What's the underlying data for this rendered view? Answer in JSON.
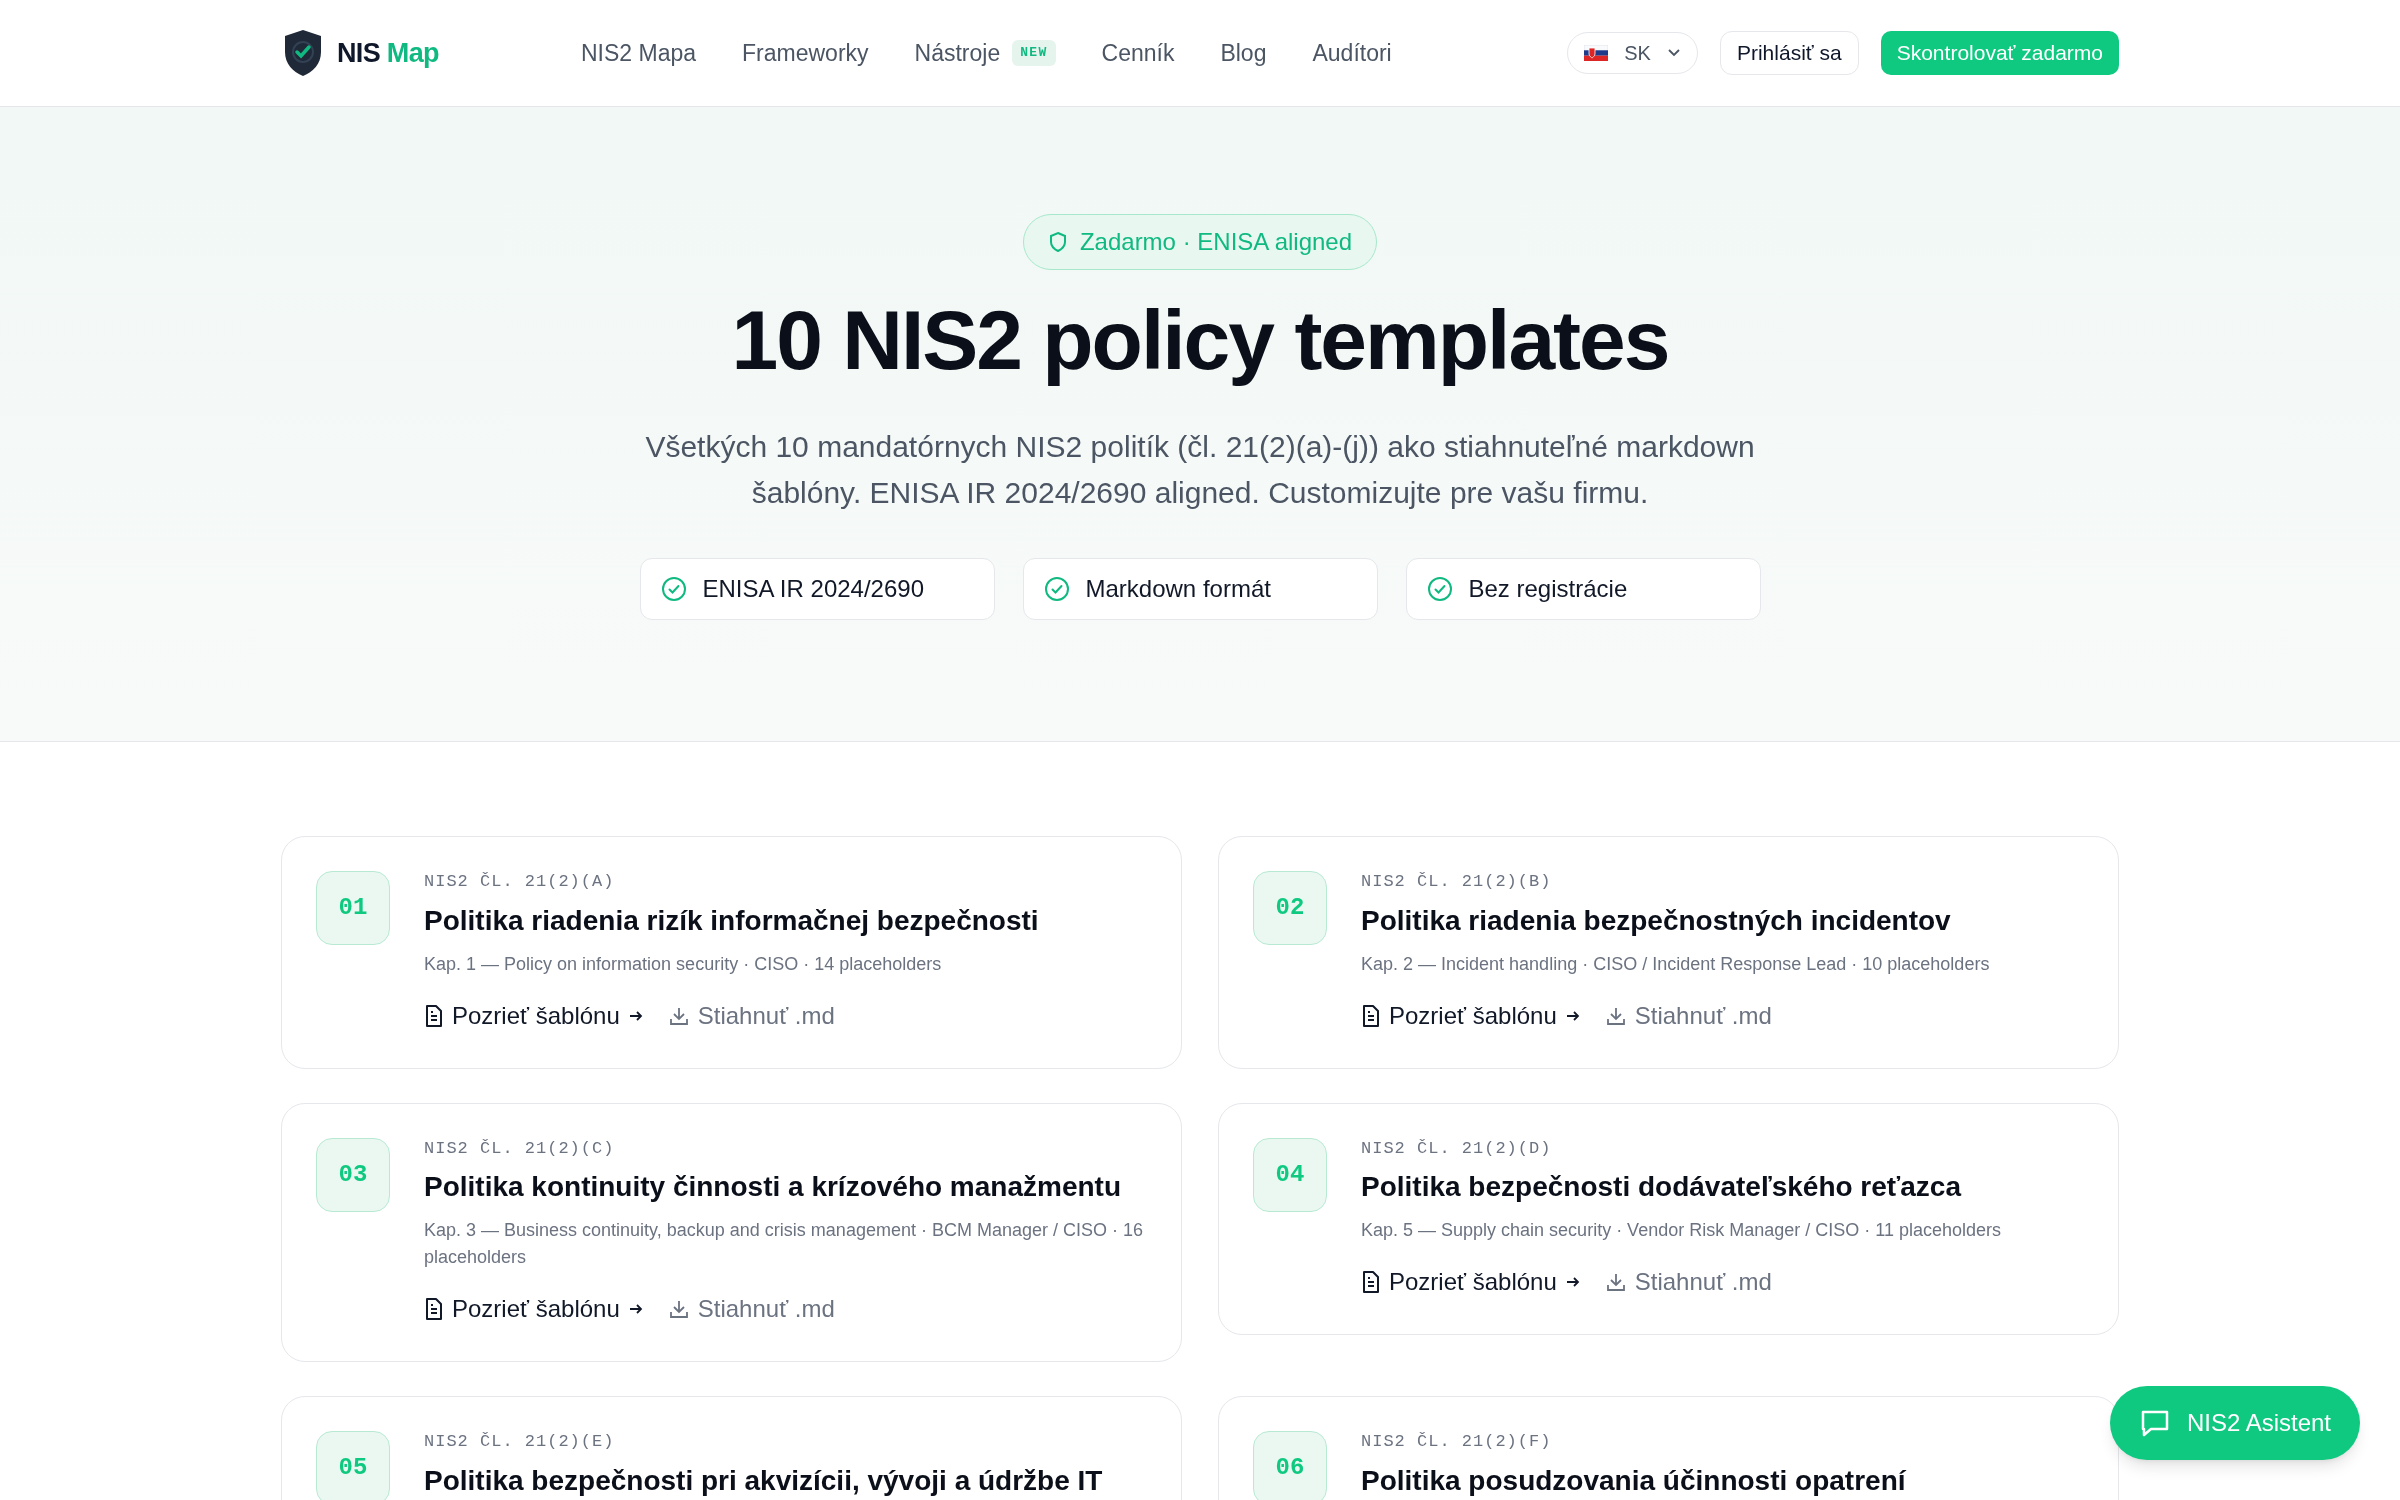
{
  "header": {
    "logo": {
      "part1": "NIS",
      "part2": "Map"
    },
    "nav": [
      {
        "label": "NIS2 Mapa"
      },
      {
        "label": "Frameworky"
      },
      {
        "label": "Nástroje",
        "badge": "NEW"
      },
      {
        "label": "Cenník"
      },
      {
        "label": "Blog"
      },
      {
        "label": "Audítori"
      }
    ],
    "language": "SK",
    "login": "Prihlásiť sa",
    "cta": "Skontrolovať zadarmo"
  },
  "hero": {
    "badge": "Zadarmo · ENISA aligned",
    "title": "10 NIS2 policy templates",
    "subtitle": "Všetkých 10 mandatórnych NIS2 politík (čl. 21(2)(a)-(j)) ako stiahnuteľné markdown šablóny. ENISA IR 2024/2690 aligned. Customizujte pre vašu firmu.",
    "features": [
      "ENISA IR 2024/2690",
      "Markdown formát",
      "Bez registrácie"
    ]
  },
  "templates": [
    {
      "number": "01",
      "article": "NIS2 ČL. 21(2)(A)",
      "title": "Politika riadenia rizík informačnej bezpečnosti",
      "meta": "Kap. 1 — Policy on information security · CISO · 14 placeholders",
      "view": "Pozrieť šablónu",
      "download": "Stiahnuť .md"
    },
    {
      "number": "02",
      "article": "NIS2 ČL. 21(2)(B)",
      "title": "Politika riadenia bezpečnostných incidentov",
      "meta": "Kap. 2 — Incident handling · CISO / Incident Response Lead · 10 placeholders",
      "view": "Pozrieť šablónu",
      "download": "Stiahnuť .md"
    },
    {
      "number": "03",
      "article": "NIS2 ČL. 21(2)(C)",
      "title": "Politika kontinuity činnosti a krízového manažmentu",
      "meta": "Kap. 3 — Business continuity, backup and crisis management · BCM Manager / CISO · 16 placeholders",
      "view": "Pozrieť šablónu",
      "download": "Stiahnuť .md"
    },
    {
      "number": "04",
      "article": "NIS2 ČL. 21(2)(D)",
      "title": "Politika bezpečnosti dodávateľského reťazca",
      "meta": "Kap. 5 — Supply chain security · Vendor Risk Manager / CISO · 11 placeholders",
      "view": "Pozrieť šablónu",
      "download": "Stiahnuť .md"
    },
    {
      "number": "05",
      "article": "NIS2 ČL. 21(2)(E)",
      "title": "Politika bezpečnosti pri akvizícii, vývoji a údržbe IT"
    },
    {
      "number": "06",
      "article": "NIS2 ČL. 21(2)(F)",
      "title": "Politika posudzovania účinnosti opatrení"
    }
  ],
  "assistant": "NIS2 Asistent"
}
